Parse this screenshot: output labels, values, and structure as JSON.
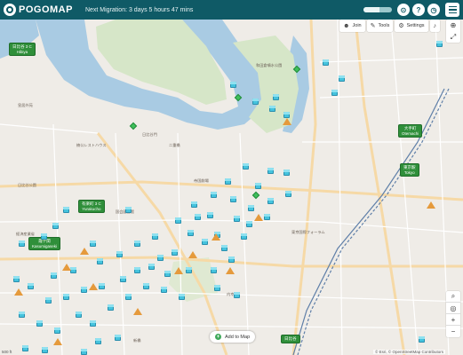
{
  "app": {
    "logo_text": "POGOMAP"
  },
  "header": {
    "migration_text": "Next Migration: 3 days 5 hours 47 mins",
    "progress": 0.55
  },
  "controls": {
    "join_label": "Join",
    "tools_label": "Tools",
    "settings_label": "Settings"
  },
  "bottom": {
    "add_to_map_label": "Add to Map",
    "attribution": "© Esri, © OpenStreetMap Contributors",
    "scale_text": "500 ft"
  },
  "stations": [
    {
      "name": "日比谷 3 C",
      "sub": "Hibiya"
    },
    {
      "name": "大手町",
      "sub": "Otemachi"
    },
    {
      "name": "東京駅",
      "sub": "Tokyo"
    },
    {
      "name": "有楽町 3 C",
      "sub": "Yurakucho"
    },
    {
      "name": "霞ケ関",
      "sub": "Kasumigaseki"
    },
    {
      "name": "日比谷",
      "sub": ""
    }
  ],
  "places": [
    "皇居外苑",
    "楠公レストハウス",
    "二重橋",
    "和田倉噴水公園",
    "日比谷公園",
    "帝国劇場",
    "東京国際フォーラム",
    "日比谷門",
    "経済産業省",
    "国会図書館",
    "内幸町",
    "新橋"
  ],
  "markers": {
    "pokestop_icon": "pokestop-icon",
    "gym_icon": "gym-icon",
    "gem_icon": "gem-icon",
    "pokestop_color": "#45c3dd",
    "gym_color": "#e59a3c",
    "gem_color": "#3fbf5a"
  }
}
